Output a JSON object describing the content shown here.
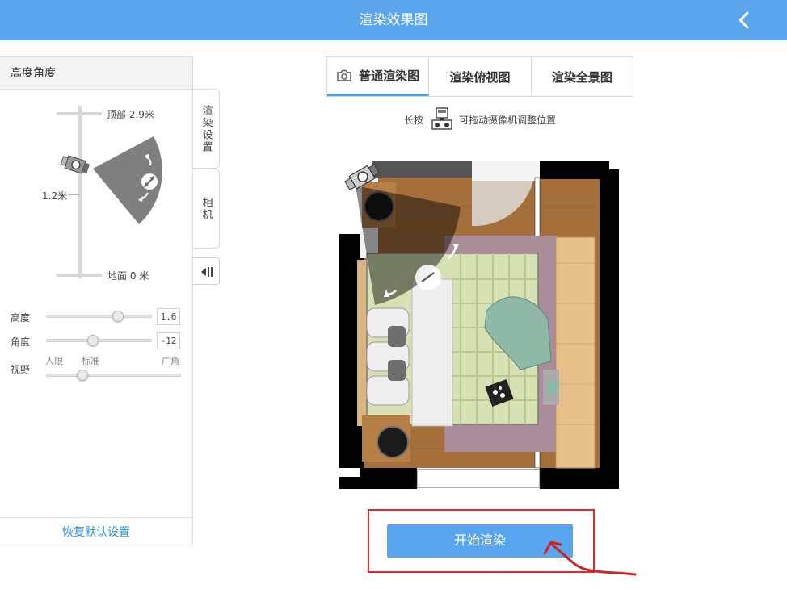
{
  "header": {
    "title": "渲染效果图"
  },
  "left_panel": {
    "title": "高度角度",
    "diagram": {
      "top_label": "顶部 2.9米",
      "mid_label": "1.2米",
      "bottom_label": "地面 0 米"
    },
    "sliders": [
      {
        "label": "高度",
        "value": "1.6",
        "level": 0.7
      },
      {
        "label": "角度",
        "value": "-12",
        "level": 0.45
      }
    ],
    "fov": {
      "label": "视野",
      "options": [
        "人眼",
        "标准",
        "广角"
      ],
      "level": 0.27
    },
    "reset_label": "恢复默认设置"
  },
  "side_tabs": {
    "render_settings": "渲染设置",
    "camera": "相机"
  },
  "render_tabs": [
    {
      "label": "普通渲染图",
      "active": true
    },
    {
      "label": "渲染俯视图",
      "active": false
    },
    {
      "label": "渲染全景图",
      "active": false
    }
  ],
  "hint": {
    "prefix": "长按",
    "suffix": "可拖动摄像机调整位置"
  },
  "start_button_label": "开始渲染",
  "colors": {
    "accent": "#5ba4ee",
    "highlight": "#e02a2a",
    "link": "#2a8fd6"
  }
}
